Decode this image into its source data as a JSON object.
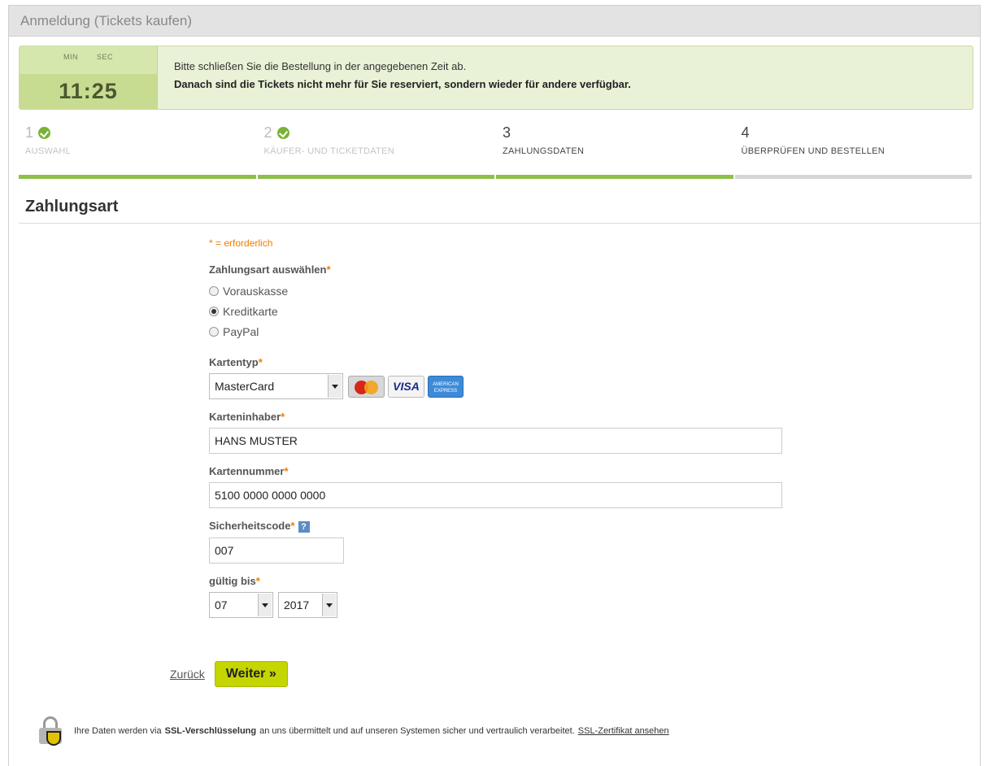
{
  "window": {
    "title": "Anmeldung (Tickets kaufen)"
  },
  "timer": {
    "min_label": "MIN",
    "sec_label": "SEC",
    "value": "11:25",
    "line1": "Bitte schließen Sie die Bestellung in der angegebenen Zeit ab.",
    "line2": "Danach sind die Tickets nicht mehr für Sie reserviert, sondern wieder für andere verfügbar."
  },
  "steps": [
    {
      "num": "1",
      "label": "AUSWAHL",
      "done": true
    },
    {
      "num": "2",
      "label": "KÄUFER- UND TICKETDATEN",
      "done": true
    },
    {
      "num": "3",
      "label": "ZAHLUNGSDATEN",
      "done": false,
      "active": true
    },
    {
      "num": "4",
      "label": "ÜBERPRÜFEN UND BESTELLEN",
      "done": false,
      "active": true
    }
  ],
  "section": {
    "title": "Zahlungsart"
  },
  "form": {
    "required_note": "* = erforderlich",
    "required_mark": "*",
    "payment_label": "Zahlungsart auswählen",
    "payment_options": [
      "Vorauskasse",
      "Kreditkarte",
      "PayPal"
    ],
    "payment_selected": "Kreditkarte",
    "card_type_label": "Kartentyp",
    "card_type_value": "MasterCard",
    "card_icons": {
      "visa": "VISA",
      "amex": "AMERICAN EXPRESS"
    },
    "holder_label": "Karteninhaber",
    "holder_value": "HANS MUSTER",
    "number_label": "Kartennummer",
    "number_value": "5100 0000 0000 0000",
    "cvc_label": "Sicherheitscode",
    "help_icon": "?",
    "cvc_value": "007",
    "valid_label": "gültig bis",
    "valid_month": "07",
    "valid_year": "2017"
  },
  "nav": {
    "back": "Zurück",
    "next": "Weiter »"
  },
  "ssl": {
    "text_before": "Ihre Daten werden via",
    "text_bold": "SSL-Verschlüsselung",
    "text_after": "an uns übermittelt und auf unseren Systemen sicher und vertraulich verarbeitet.",
    "link": "SSL-Zertifikat ansehen"
  },
  "colors": {
    "accent_green": "#8cc04a",
    "required_orange": "#f07c00",
    "button_lime": "#c4d500"
  }
}
